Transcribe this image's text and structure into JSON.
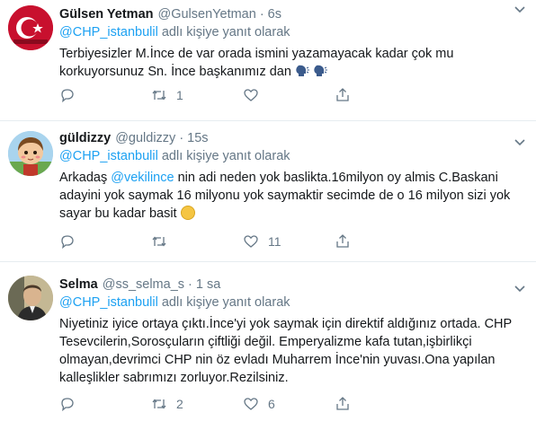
{
  "tweets": [
    {
      "name": "Gülsen Yetman",
      "handle": "@GulsenYetman",
      "dot": "·",
      "time": "6s",
      "reply_to": "@CHP_istanbulil",
      "reply_suffix": " adlı kişiye yanıt olarak",
      "text_1": "Terbiyesizler M.İnce de var orada ismini yazamayacak kadar çok mu korkuyorsunuz Sn. İnce başkanımız dan",
      "emoji_1": "speaking-head",
      "emoji_2": "speaking-head",
      "reply_count": "",
      "retweet_count": "1",
      "like_count": "",
      "avatar": "turkish-flag-circle-avatar"
    },
    {
      "name": "güldizzy",
      "handle": "@guldizzy",
      "dot": "·",
      "time": "15s",
      "reply_to": "@CHP_istanbulil",
      "reply_suffix": " adlı kişiye yanıt olarak",
      "text_pre": "Arkadaş ",
      "text_mention": "@vekilince",
      "text_post": " nin adi neden yok baslikta.16milyon oy almis C.Baskani adayini yok saymak 16 milyonu yok saymaktir secimde de o 16 milyon sizi yok sayar bu kadar basit ",
      "emoji": "thinking-face",
      "reply_count": "",
      "retweet_count": "",
      "like_count": "11",
      "avatar": "cartoon-girl-avatar"
    },
    {
      "name": "Selma",
      "handle": "@ss_selma_s",
      "dot": "·",
      "time": "1 sa",
      "reply_to": "@CHP_istanbulil",
      "reply_suffix": " adlı kişiye yanıt olarak",
      "text": "Niyetiniz iyice ortaya çıktı.İnce'yi yok saymak için direktif aldığınız ortada. CHP Tesevcilerin,Sorosçuların çiftliği değil. Emperyalizme kafa tutan,işbirlikçi olmayan,devrimci CHP nin öz evladı Muharrem İnce'nin yuvası.Ona yapılan kalleşlikler sabrımızı zorluyor.Rezilsiniz.",
      "reply_count": "",
      "retweet_count": "2",
      "like_count": "6",
      "avatar": "portrait-photo-avatar"
    }
  ],
  "colors": {
    "accent": "#1da1f2",
    "muted": "#657786",
    "text": "#14171a",
    "divider": "#e6ecf0"
  },
  "icons": [
    "reply-icon",
    "retweet-icon",
    "like-icon",
    "share-icon",
    "chevron-down-icon"
  ]
}
